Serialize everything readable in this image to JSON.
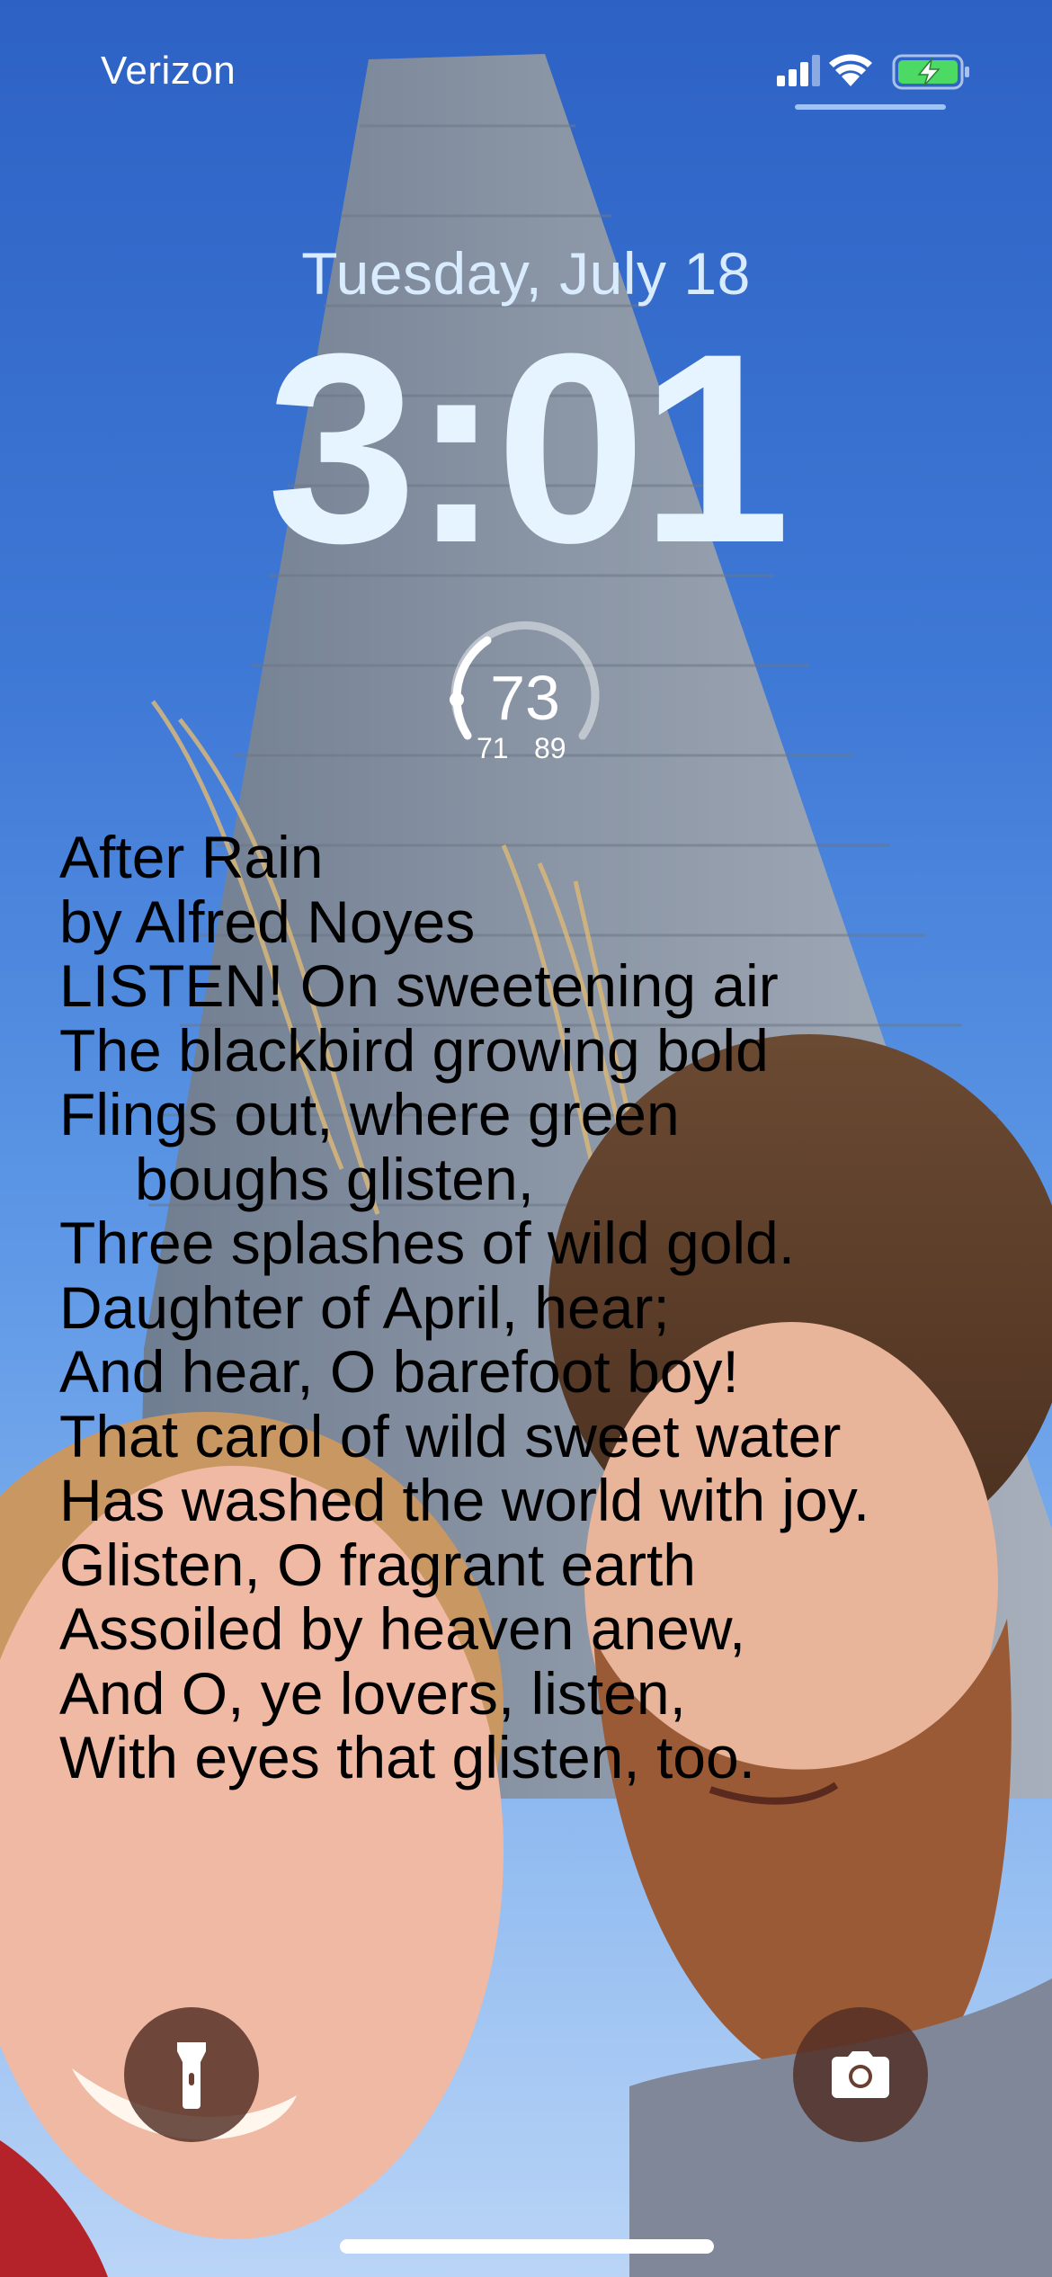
{
  "status_bar": {
    "carrier": "Verizon",
    "signal_icon": "cellular-signal-icon",
    "wifi_icon": "wifi-icon",
    "battery_icon": "battery-charging-icon",
    "battery_color": "#4cd964"
  },
  "lock_screen": {
    "date": "Tuesday, July 18",
    "time": "3:01"
  },
  "weather_widget": {
    "temperature": "73",
    "low": "71",
    "high": "89"
  },
  "poem_widget": {
    "lines": [
      "After Rain",
      "by Alfred Noyes",
      "LISTEN! On sweetening air",
      "The blackbird growing bold",
      "Flings out, where green",
      "boughs glisten,",
      "Three splashes of wild gold.",
      "Daughter of April, hear;",
      "And hear, O barefoot boy!",
      "That carol of wild sweet water",
      "Has washed the world with joy.",
      "Glisten, O fragrant earth",
      "Assoiled by heaven anew,",
      "And O, ye lovers, listen,",
      "With eyes that glisten, too."
    ]
  },
  "controls": {
    "flashlight_icon": "flashlight-icon",
    "camera_icon": "camera-icon"
  }
}
